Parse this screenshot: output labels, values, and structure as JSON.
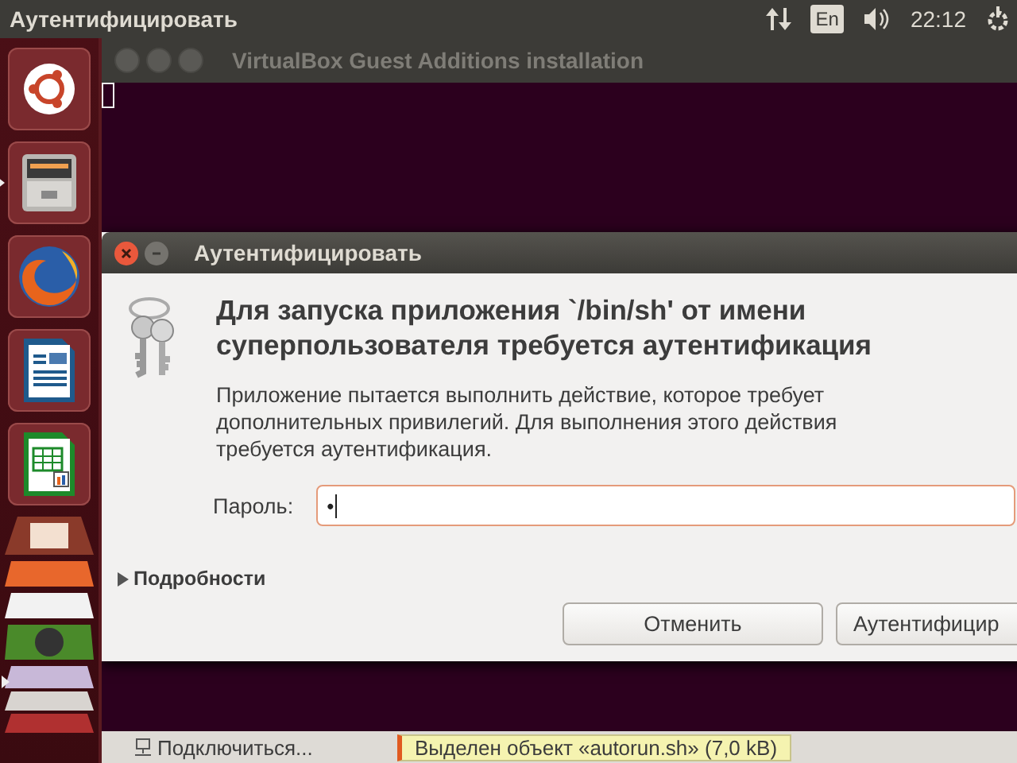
{
  "top_panel": {
    "title": "Аутентифицировать",
    "keyboard_layout": "En",
    "clock": "22:12"
  },
  "launcher": {
    "items": [
      {
        "kind": "ubuntu",
        "running": false
      },
      {
        "kind": "files",
        "running": true
      },
      {
        "kind": "firefox",
        "running": false
      },
      {
        "kind": "writer",
        "running": false
      },
      {
        "kind": "calc",
        "running": false
      },
      {
        "kind": "stack",
        "running": true
      }
    ]
  },
  "terminal": {
    "title": "VirtualBox Guest Additions installation"
  },
  "dialog": {
    "title": "Аутентифицировать",
    "heading": "Для запуска приложения `/bin/sh' от имени суперпользователя требуется аутентификация",
    "body": "Приложение пытается выполнить действие, которое требует дополнительных привилегий. Для выполнения этого действия требуется аутентификация.",
    "password_label": "Пароль:",
    "password_value": "•",
    "details": {
      "label": "Подробности",
      "expanded": false
    },
    "buttons": [
      "Отменить",
      "Аутентифицир"
    ]
  },
  "file_manager": {
    "sidebar_item": "Подключиться...",
    "status": "Выделен объект «autorun.sh» (7,0 kB)"
  }
}
